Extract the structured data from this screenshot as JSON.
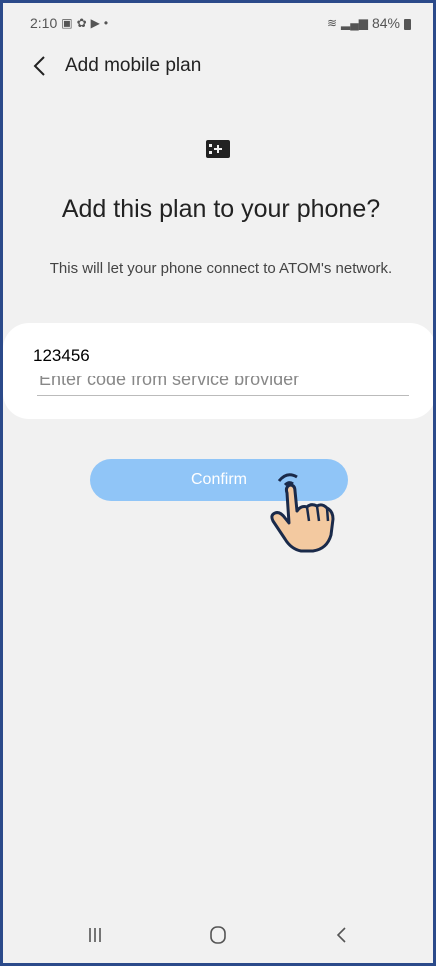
{
  "status_bar": {
    "time": "2:10",
    "battery": "84%",
    "icons": [
      "gallery-icon",
      "settings-icon",
      "youtube-icon",
      "dot-icon",
      "wifi-calling-icon",
      "signal-icon",
      "battery-icon"
    ]
  },
  "header": {
    "title": "Add mobile plan"
  },
  "main": {
    "heading": "Add this plan to your phone?",
    "description": "This will let your phone connect to ATOM's network.",
    "code_value": "123456",
    "placeholder": "Enter code from service provider",
    "confirm_label": "Confirm"
  },
  "nav": {
    "icons": [
      "recents-icon",
      "home-icon",
      "back-icon"
    ]
  },
  "colors": {
    "accent": "#90c5f7",
    "frame": "#2b4a8a",
    "background": "#f1f1f1"
  }
}
